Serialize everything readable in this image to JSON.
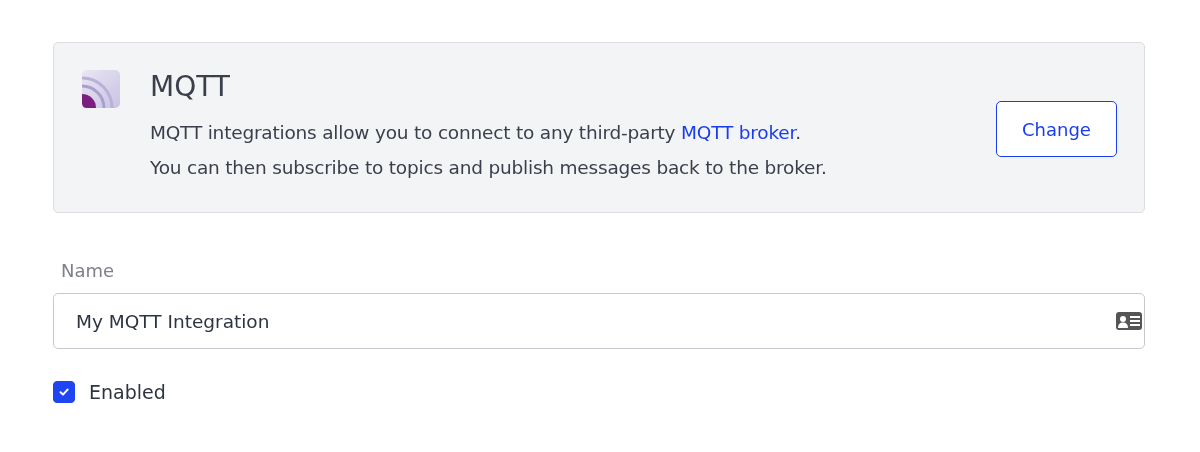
{
  "integration": {
    "title": "MQTT",
    "description": {
      "before": "MQTT integrations allow you to connect to any third-party ",
      "link": "MQTT broker",
      "after": ".",
      "second_line": "You can then subscribe to topics and publish messages back to the broker."
    },
    "button": "Change"
  },
  "name_field": {
    "label": "Name",
    "value": "My MQTT Integration"
  },
  "enabled": {
    "label": "Enabled",
    "checked": true
  }
}
